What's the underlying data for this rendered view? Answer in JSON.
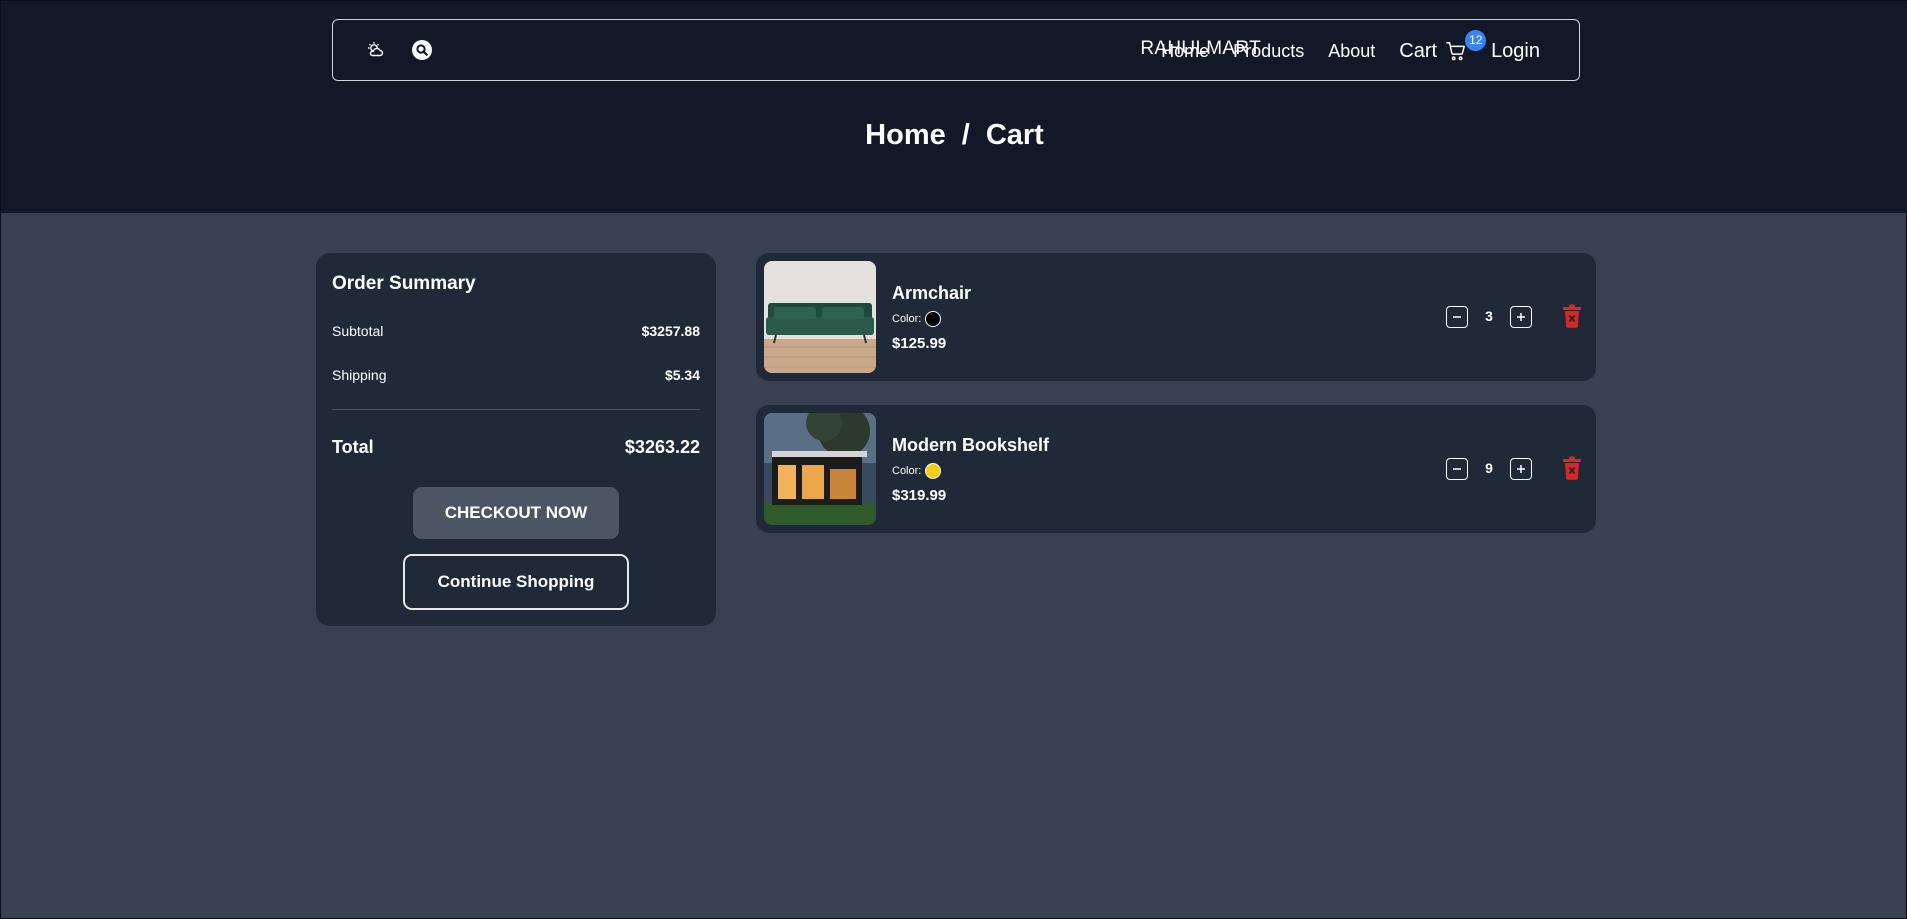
{
  "nav": {
    "brand": "RAHULMART",
    "links": [
      "Home",
      "Products",
      "About"
    ],
    "cart_label": "Cart",
    "cart_count": "12",
    "login": "Login"
  },
  "breadcrumb": {
    "home": "Home",
    "separator": "/",
    "current": "Cart"
  },
  "summary": {
    "title": "Order Summary",
    "subtotal_label": "Subtotal",
    "subtotal_value": "$3257.88",
    "shipping_label": "Shipping",
    "shipping_value": "$5.34",
    "total_label": "Total",
    "total_value": "$3263.22",
    "checkout_label": "CHECKOUT NOW",
    "continue_label": "Continue Shopping"
  },
  "items": [
    {
      "name": "Armchair",
      "color_label": "Color:",
      "color": "#000000",
      "price": "$125.99",
      "quantity": "3"
    },
    {
      "name": "Modern Bookshelf",
      "color_label": "Color:",
      "color": "#facc15",
      "price": "$319.99",
      "quantity": "9"
    }
  ],
  "colors": {
    "header_bg": "#111827",
    "page_bg": "#374151",
    "card_bg": "#1f2937",
    "badge": "#3b82f6",
    "delete": "#dc2626"
  },
  "icons": {
    "theme": "cloud-sun-icon",
    "search": "search-icon",
    "cart": "cart-icon",
    "delete": "trash-icon",
    "minus": "minus-icon",
    "plus": "plus-icon"
  }
}
